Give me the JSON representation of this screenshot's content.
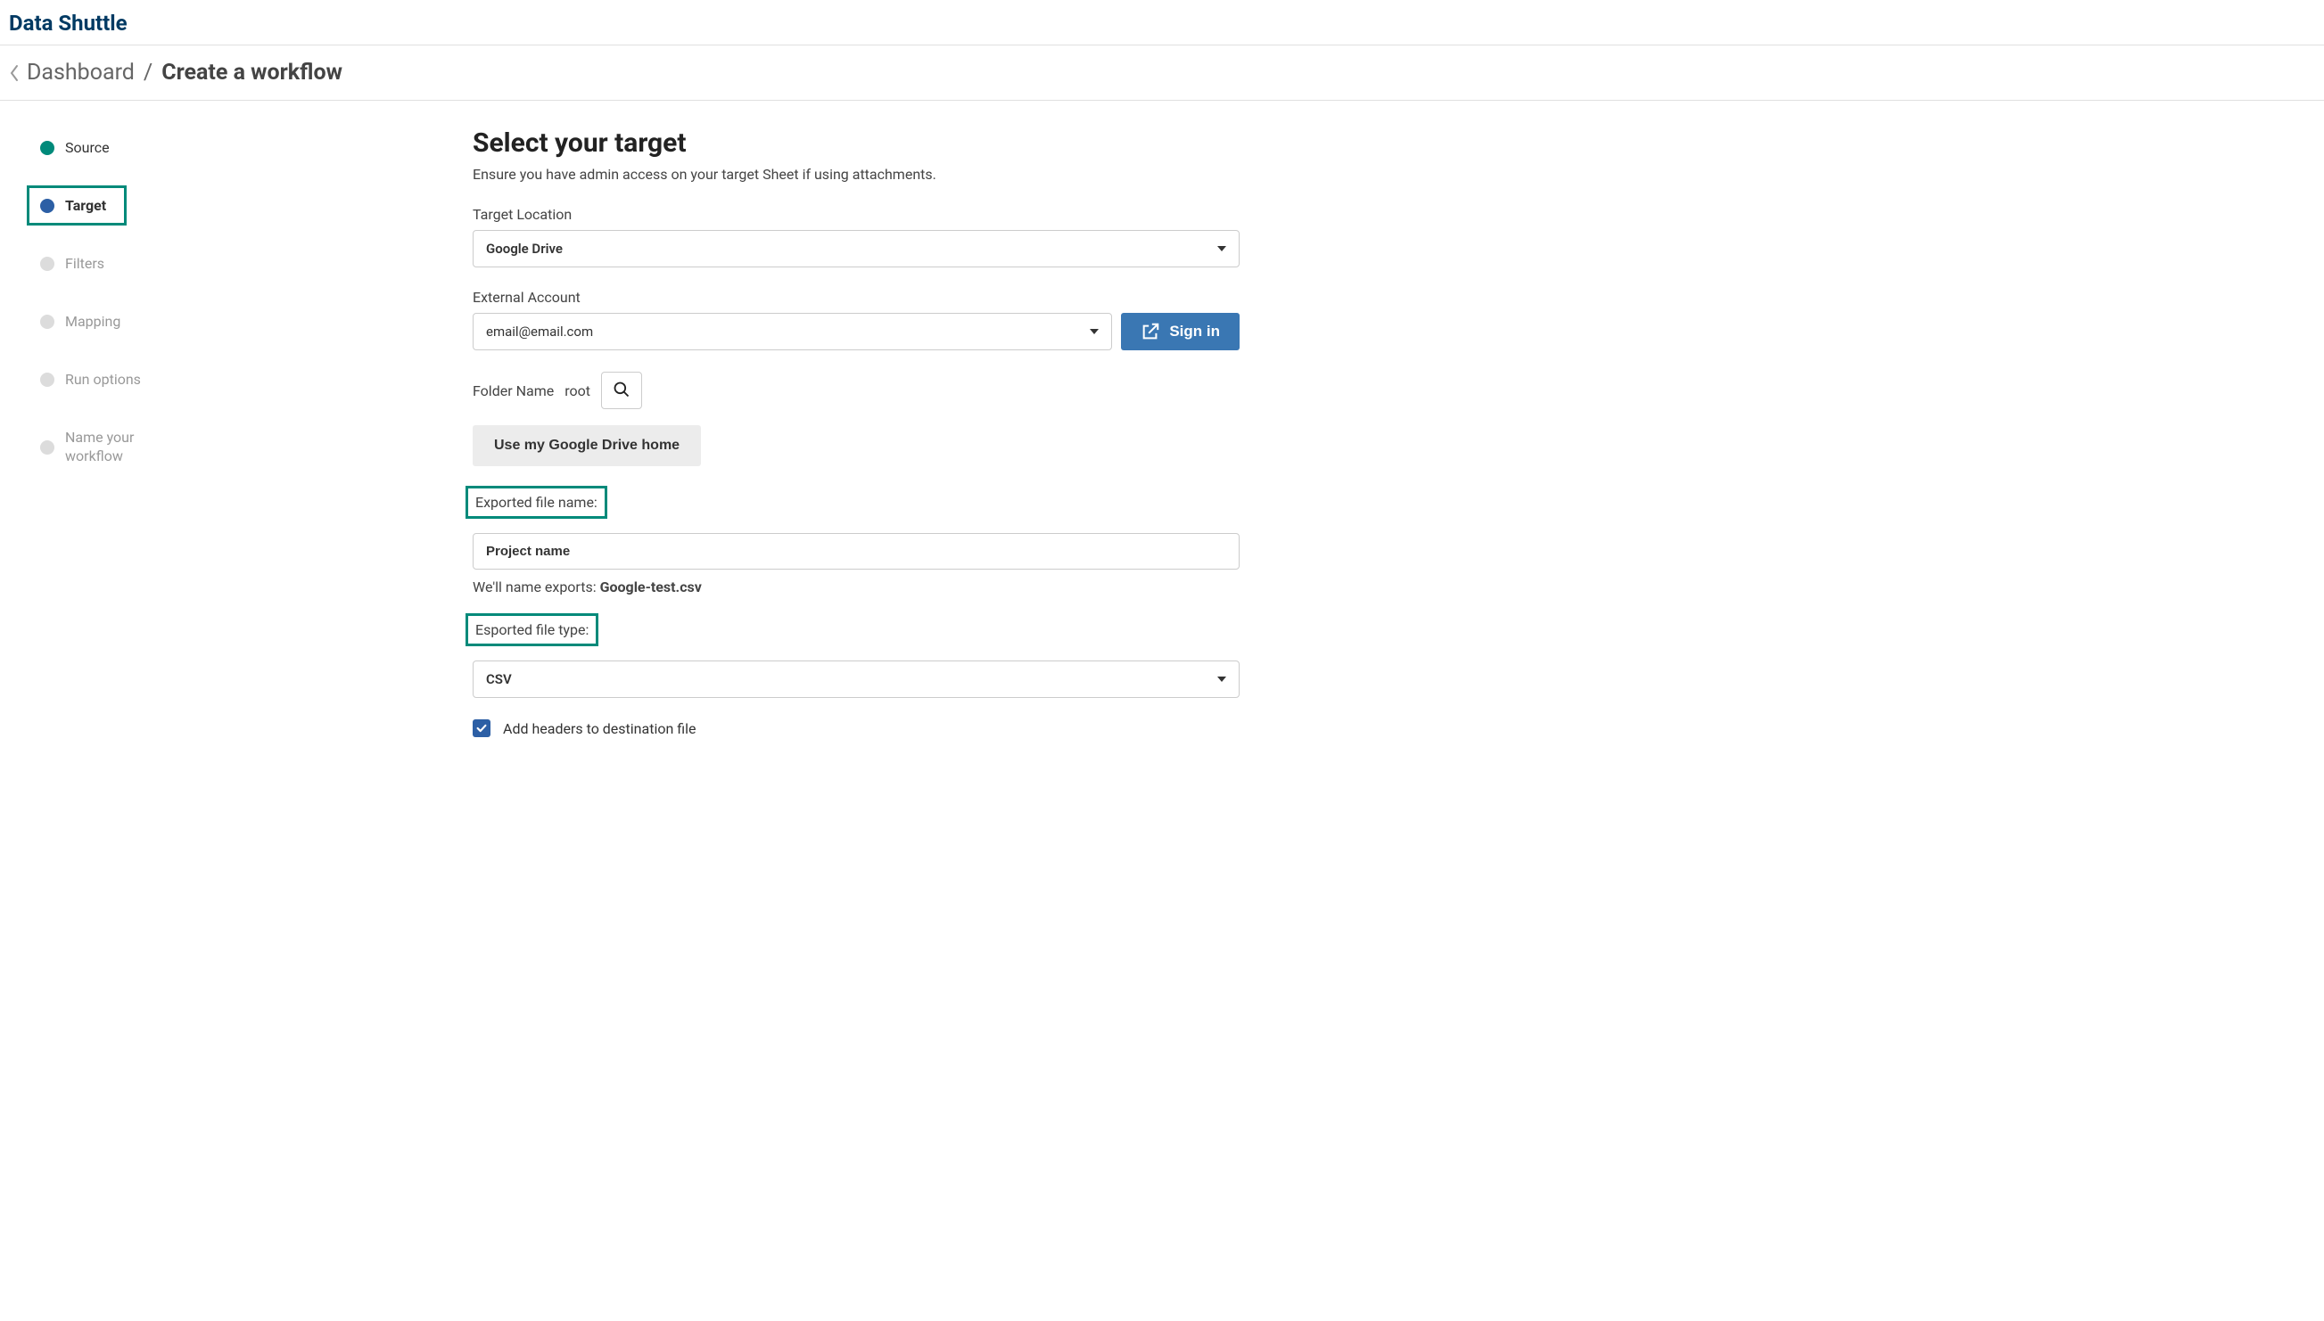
{
  "app": {
    "title": "Data Shuttle"
  },
  "breadcrumb": {
    "parent": "Dashboard",
    "separator": "/",
    "current": "Create a workflow"
  },
  "sidebar": {
    "steps": [
      {
        "label": "Source",
        "status": "complete"
      },
      {
        "label": "Target",
        "status": "current"
      },
      {
        "label": "Filters",
        "status": "pending"
      },
      {
        "label": "Mapping",
        "status": "pending"
      },
      {
        "label": "Run options",
        "status": "pending"
      },
      {
        "label": "Name your workflow",
        "status": "pending"
      }
    ]
  },
  "main": {
    "heading": "Select your target",
    "subtext": "Ensure you have admin access on your target Sheet if using attachments.",
    "target_location": {
      "label": "Target Location",
      "value": "Google Drive"
    },
    "external_account": {
      "label": "External Account",
      "value": "email@email.com",
      "signin_label": "Sign in"
    },
    "folder": {
      "label": "Folder Name",
      "value": "root"
    },
    "home_button": "Use my Google Drive home",
    "exported_name": {
      "label": "Exported file name:",
      "value": "Project name",
      "helper_prefix": "We'll name exports: ",
      "helper_value": "Google-test.csv"
    },
    "exported_type": {
      "label": "Esported file type:",
      "value": "CSV"
    },
    "add_headers": {
      "label": "Add headers to destination file",
      "checked": true
    }
  }
}
